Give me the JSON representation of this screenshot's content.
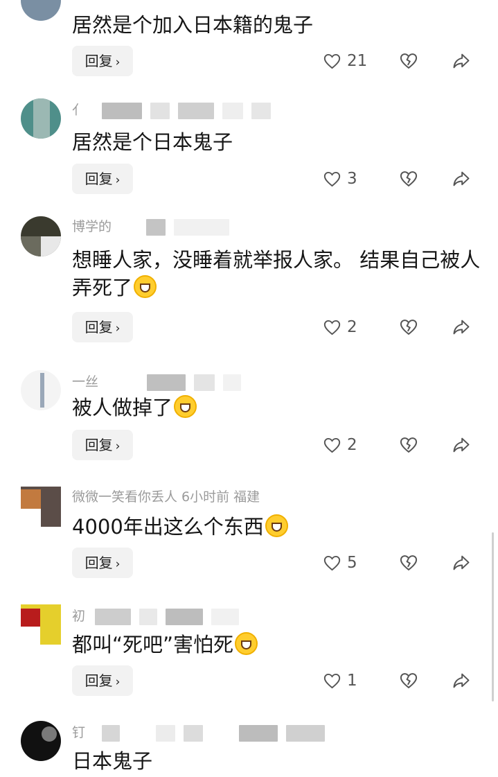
{
  "reply_label": "回复",
  "chevron": "›",
  "comments": [
    {
      "meta": "",
      "text": "居然是个加入日本籍的鬼子",
      "likes": "21"
    },
    {
      "meta": "亻",
      "text": "居然是个日本鬼子",
      "likes": "3"
    },
    {
      "meta": "博学的",
      "text": "想睡人家，没睡着就举报人家。 结果自己被人弄死了",
      "emoji": "grinning-emoji",
      "likes": "2"
    },
    {
      "meta": "一丝",
      "text": "被人做掉了",
      "emoji": "laughing-crying-emoji",
      "likes": "2"
    },
    {
      "meta": "微微一笑看你丢人  6小时前  福建",
      "text": "4000年出这么个东西",
      "emoji": "laughing-crying-emoji",
      "likes": "5"
    },
    {
      "meta": "初",
      "text": "都叫“死吧”害怕死",
      "emoji": "laughing-crying-emoji",
      "likes": "1"
    },
    {
      "meta": "钉",
      "text": "日本鬼子"
    }
  ],
  "colors": {
    "meta": "#9b9b9b",
    "text": "#161616",
    "reply_bg": "#f2f2f2",
    "icon": "#555555"
  },
  "icons": {
    "like": "heart-icon",
    "dislike": "broken-heart-icon",
    "share": "share-arrow-icon"
  }
}
